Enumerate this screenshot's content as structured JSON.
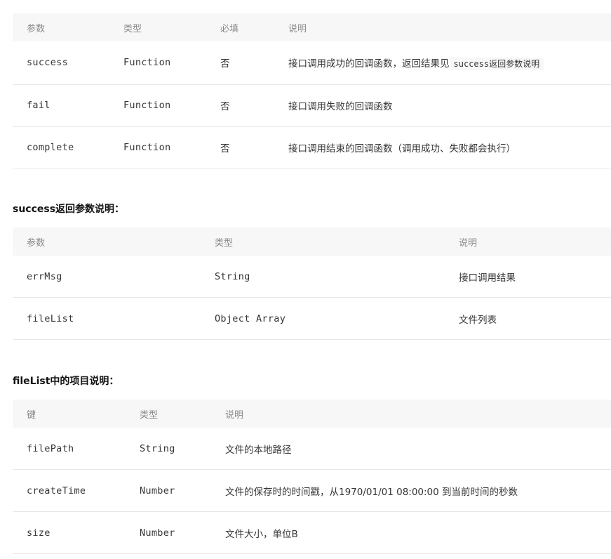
{
  "table1": {
    "headers": [
      "参数",
      "类型",
      "必填",
      "说明"
    ],
    "rows": [
      {
        "name": "success",
        "type": "Function",
        "required": "否",
        "desc": "接口调用成功的回调函数，返回结果见",
        "desc_code": "success返回参数说明"
      },
      {
        "name": "fail",
        "type": "Function",
        "required": "否",
        "desc": "接口调用失败的回调函数"
      },
      {
        "name": "complete",
        "type": "Function",
        "required": "否",
        "desc": "接口调用结束的回调函数（调用成功、失败都会执行）"
      }
    ]
  },
  "section2": {
    "title": "success返回参数说明："
  },
  "table2": {
    "headers": [
      "参数",
      "类型",
      "说明"
    ],
    "rows": [
      {
        "name": "errMsg",
        "type": "String",
        "desc": "接口调用结果"
      },
      {
        "name": "fileList",
        "type": "Object Array",
        "desc": "文件列表"
      }
    ]
  },
  "section3": {
    "title": "fileList中的项目说明："
  },
  "table3": {
    "headers": [
      "键",
      "类型",
      "说明"
    ],
    "rows": [
      {
        "name": "filePath",
        "type": "String",
        "desc": "文件的本地路径"
      },
      {
        "name": "createTime",
        "type": "Number",
        "desc": "文件的保存时的时间戳，从1970/01/01 08:00:00 到当前时间的秒数"
      },
      {
        "name": "size",
        "type": "Number",
        "desc": "文件大小，单位B"
      }
    ]
  }
}
